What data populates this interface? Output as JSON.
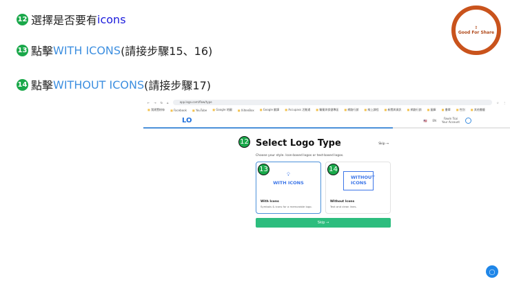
{
  "steps": [
    {
      "num": "12",
      "pre": "選擇是否要有",
      "hl": "icons",
      "post": ""
    },
    {
      "num": "13",
      "pre": "點擊",
      "hl": "WITH ICONS",
      "post": "(請接步驟15、16)"
    },
    {
      "num": "14",
      "pre": "點擊",
      "hl": "WITHOUT ICONS",
      "post": "(請接步驟17)"
    }
  ],
  "logo": {
    "text": "Good For Share"
  },
  "browser": {
    "url": "app.logo.com/flow/type",
    "bookmarks": [
      "我建置粉絲",
      "Facebook",
      "YouTube",
      "Google 地圖",
      "XiltenBox",
      "Google 翻譯",
      "Accupass 活動通",
      "醫藥與保健專區",
      "網路行銷",
      "線上課程",
      "新聞與資訊",
      "網路行銷",
      "圖庫",
      "書單",
      "性別",
      "其他書籤"
    ]
  },
  "app": {
    "logo": "LOGO",
    "lang": "EN",
    "user_name": "Fawin Tsai",
    "user_sub": "Your Account",
    "progress": 0.68,
    "title": "Select Logo Type",
    "skip_link": "Skip →",
    "subtitle": "Choose your style. Icon-based logos or text-based logos.",
    "cards": [
      {
        "badge": "13",
        "art": "WITH ICONS",
        "title": "With Icons",
        "desc": "Symbols & icons for a memorable logo."
      },
      {
        "badge": "14",
        "art": "WITHOUT ICONS",
        "title": "Without Icons",
        "desc": "Text and clean lines."
      }
    ],
    "title_badge": "12",
    "skip_button": "Skip →"
  }
}
